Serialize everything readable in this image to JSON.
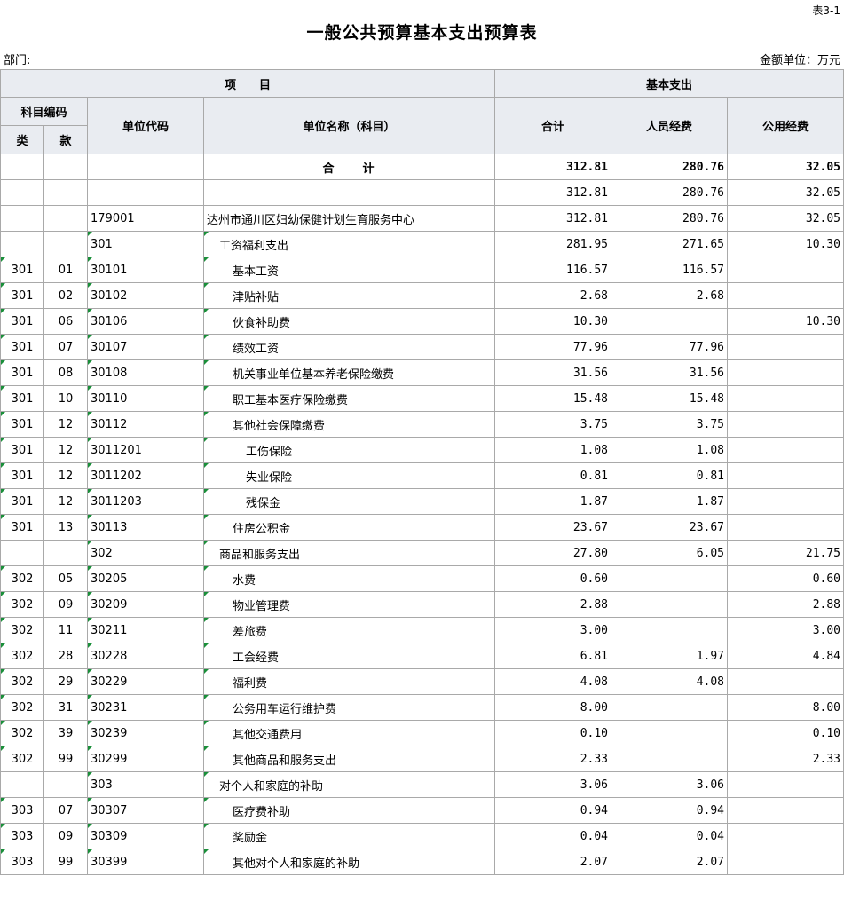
{
  "header": {
    "table_no": "表3-1",
    "title": "一般公共预算基本支出预算表",
    "dept_label": "部门:",
    "unit_label": "金额单位：万元"
  },
  "columns": {
    "item": "项　　目",
    "basic_expense": "基本支出",
    "subject_code": "科目编码",
    "class": "类",
    "kind": "款",
    "unit_code": "单位代码",
    "unit_name": "单位名称（科目）",
    "total": "合计",
    "personnel": "人员经费",
    "public": "公用经费"
  },
  "rows": [
    {
      "cls": "",
      "kuan": "",
      "code": "",
      "name": "合　　计",
      "total": "312.81",
      "personnel": "280.76",
      "public": "32.05",
      "level": 0,
      "mark": false,
      "is_total": true
    },
    {
      "cls": "",
      "kuan": "",
      "code": "",
      "name": "",
      "total": "312.81",
      "personnel": "280.76",
      "public": "32.05",
      "level": 0,
      "mark": false
    },
    {
      "cls": "",
      "kuan": "",
      "code": "179001",
      "name": "达州市通川区妇幼保健计划生育服务中心",
      "total": "312.81",
      "personnel": "280.76",
      "public": "32.05",
      "level": 0,
      "mark": false
    },
    {
      "cls": "",
      "kuan": "",
      "code": "301",
      "name": "工资福利支出",
      "total": "281.95",
      "personnel": "271.65",
      "public": "10.30",
      "level": 1,
      "mark": true
    },
    {
      "cls": "301",
      "kuan": "01",
      "code": "30101",
      "name": "基本工资",
      "total": "116.57",
      "personnel": "116.57",
      "public": "",
      "level": 2,
      "mark": true
    },
    {
      "cls": "301",
      "kuan": "02",
      "code": "30102",
      "name": "津贴补贴",
      "total": "2.68",
      "personnel": "2.68",
      "public": "",
      "level": 2,
      "mark": true
    },
    {
      "cls": "301",
      "kuan": "06",
      "code": "30106",
      "name": "伙食补助费",
      "total": "10.30",
      "personnel": "",
      "public": "10.30",
      "level": 2,
      "mark": true
    },
    {
      "cls": "301",
      "kuan": "07",
      "code": "30107",
      "name": "绩效工资",
      "total": "77.96",
      "personnel": "77.96",
      "public": "",
      "level": 2,
      "mark": true
    },
    {
      "cls": "301",
      "kuan": "08",
      "code": "30108",
      "name": "机关事业单位基本养老保险缴费",
      "total": "31.56",
      "personnel": "31.56",
      "public": "",
      "level": 2,
      "mark": true
    },
    {
      "cls": "301",
      "kuan": "10",
      "code": "30110",
      "name": "职工基本医疗保险缴费",
      "total": "15.48",
      "personnel": "15.48",
      "public": "",
      "level": 2,
      "mark": true
    },
    {
      "cls": "301",
      "kuan": "12",
      "code": "30112",
      "name": "其他社会保障缴费",
      "total": "3.75",
      "personnel": "3.75",
      "public": "",
      "level": 2,
      "mark": true
    },
    {
      "cls": "301",
      "kuan": "12",
      "code": "3011201",
      "name": "工伤保险",
      "total": "1.08",
      "personnel": "1.08",
      "public": "",
      "level": 3,
      "mark": true
    },
    {
      "cls": "301",
      "kuan": "12",
      "code": "3011202",
      "name": "失业保险",
      "total": "0.81",
      "personnel": "0.81",
      "public": "",
      "level": 3,
      "mark": true
    },
    {
      "cls": "301",
      "kuan": "12",
      "code": "3011203",
      "name": "残保金",
      "total": "1.87",
      "personnel": "1.87",
      "public": "",
      "level": 3,
      "mark": true
    },
    {
      "cls": "301",
      "kuan": "13",
      "code": "30113",
      "name": "住房公积金",
      "total": "23.67",
      "personnel": "23.67",
      "public": "",
      "level": 2,
      "mark": true
    },
    {
      "cls": "",
      "kuan": "",
      "code": "302",
      "name": "商品和服务支出",
      "total": "27.80",
      "personnel": "6.05",
      "public": "21.75",
      "level": 1,
      "mark": true
    },
    {
      "cls": "302",
      "kuan": "05",
      "code": "30205",
      "name": "水费",
      "total": "0.60",
      "personnel": "",
      "public": "0.60",
      "level": 2,
      "mark": true
    },
    {
      "cls": "302",
      "kuan": "09",
      "code": "30209",
      "name": "物业管理费",
      "total": "2.88",
      "personnel": "",
      "public": "2.88",
      "level": 2,
      "mark": true
    },
    {
      "cls": "302",
      "kuan": "11",
      "code": "30211",
      "name": "差旅费",
      "total": "3.00",
      "personnel": "",
      "public": "3.00",
      "level": 2,
      "mark": true
    },
    {
      "cls": "302",
      "kuan": "28",
      "code": "30228",
      "name": "工会经费",
      "total": "6.81",
      "personnel": "1.97",
      "public": "4.84",
      "level": 2,
      "mark": true
    },
    {
      "cls": "302",
      "kuan": "29",
      "code": "30229",
      "name": "福利费",
      "total": "4.08",
      "personnel": "4.08",
      "public": "",
      "level": 2,
      "mark": true
    },
    {
      "cls": "302",
      "kuan": "31",
      "code": "30231",
      "name": "公务用车运行维护费",
      "total": "8.00",
      "personnel": "",
      "public": "8.00",
      "level": 2,
      "mark": true
    },
    {
      "cls": "302",
      "kuan": "39",
      "code": "30239",
      "name": "其他交通费用",
      "total": "0.10",
      "personnel": "",
      "public": "0.10",
      "level": 2,
      "mark": true
    },
    {
      "cls": "302",
      "kuan": "99",
      "code": "30299",
      "name": "其他商品和服务支出",
      "total": "2.33",
      "personnel": "",
      "public": "2.33",
      "level": 2,
      "mark": true
    },
    {
      "cls": "",
      "kuan": "",
      "code": "303",
      "name": "对个人和家庭的补助",
      "total": "3.06",
      "personnel": "3.06",
      "public": "",
      "level": 1,
      "mark": true
    },
    {
      "cls": "303",
      "kuan": "07",
      "code": "30307",
      "name": "医疗费补助",
      "total": "0.94",
      "personnel": "0.94",
      "public": "",
      "level": 2,
      "mark": true
    },
    {
      "cls": "303",
      "kuan": "09",
      "code": "30309",
      "name": "奖励金",
      "total": "0.04",
      "personnel": "0.04",
      "public": "",
      "level": 2,
      "mark": true
    },
    {
      "cls": "303",
      "kuan": "99",
      "code": "30399",
      "name": "其他对个人和家庭的补助",
      "total": "2.07",
      "personnel": "2.07",
      "public": "",
      "level": 2,
      "mark": true
    }
  ]
}
